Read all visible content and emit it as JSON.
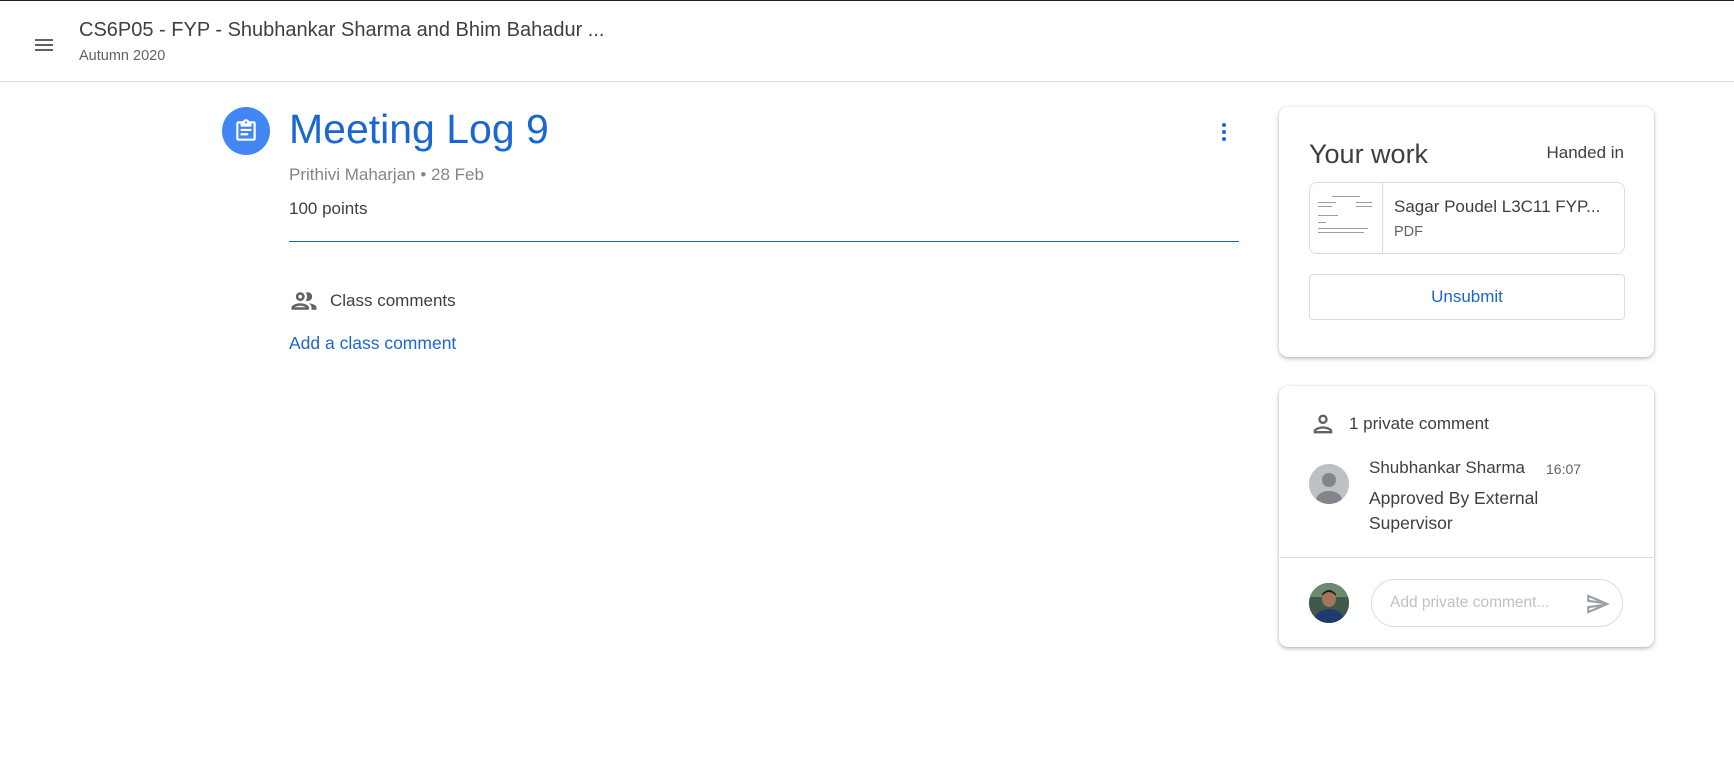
{
  "header": {
    "class_title": "CS6P05 - FYP - Shubhankar Sharma and Bhim Bahadur ...",
    "class_subtitle": "Autumn 2020",
    "menu_icon": "hamburger-menu-icon"
  },
  "assignment": {
    "icon": "assignment-clipboard-icon",
    "title": "Meeting Log 9",
    "meta": "Prithivi Maharjan • 28 Feb",
    "points": "100 points",
    "more_icon": "more-vert-icon"
  },
  "class_comments": {
    "icon": "people-icon",
    "label": "Class comments",
    "add_link": "Add a class comment"
  },
  "your_work": {
    "title": "Your work",
    "status": "Handed in",
    "attachment": {
      "name": "Sagar Poudel L3C11 FYP...",
      "type": "PDF"
    },
    "unsubmit_label": "Unsubmit"
  },
  "private_comments": {
    "icon": "person-icon",
    "count_label": "1 private comment",
    "comments": [
      {
        "author": "Shubhankar Sharma",
        "time": "16:07",
        "text": "Approved By External Supervisor"
      }
    ],
    "input_placeholder": "Add private comment...",
    "send_icon": "send-icon"
  },
  "colors": {
    "accent": "#1967d2",
    "icon_bg": "#4285f4",
    "text": "#3c4043",
    "muted": "#5f6368",
    "border": "#dadce0"
  }
}
